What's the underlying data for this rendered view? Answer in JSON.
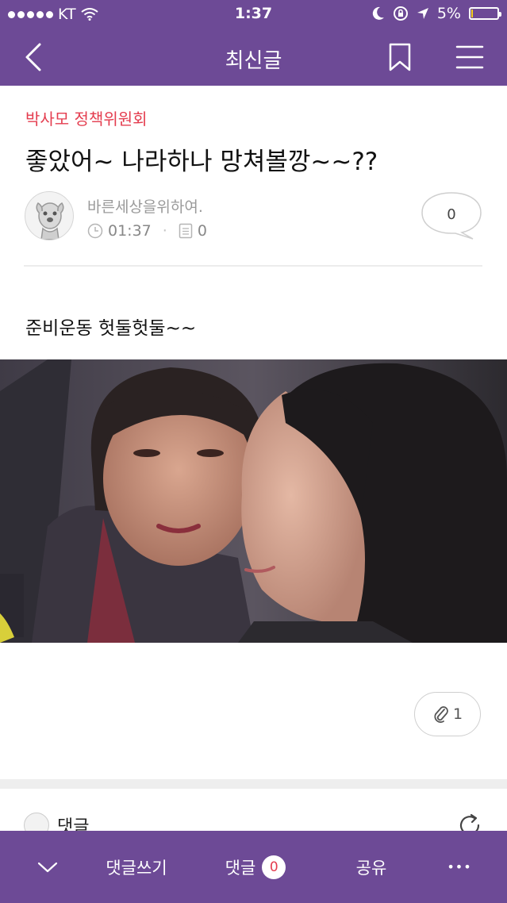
{
  "status": {
    "carrier": "KT",
    "time": "1:37",
    "battery": "5%",
    "battery_level": 0.05
  },
  "nav": {
    "title": "최신글"
  },
  "post": {
    "board": "박사모 정책위원회",
    "title": "좋았어~ 나라하나 망쳐볼깡~~??",
    "author": "바른세상을위하여.",
    "time": "01:37",
    "views": "0",
    "comment_count": "0",
    "body": "준비운동 헛둘헛둘~~",
    "attachments": "1"
  },
  "comments": {
    "label": "댓글"
  },
  "toolbar": {
    "write": "댓글쓰기",
    "comments": "댓글",
    "comments_badge": "0",
    "share": "공유",
    "more": "•••"
  },
  "colors": {
    "accent": "#6d4a96",
    "board": "#e43d4f"
  }
}
